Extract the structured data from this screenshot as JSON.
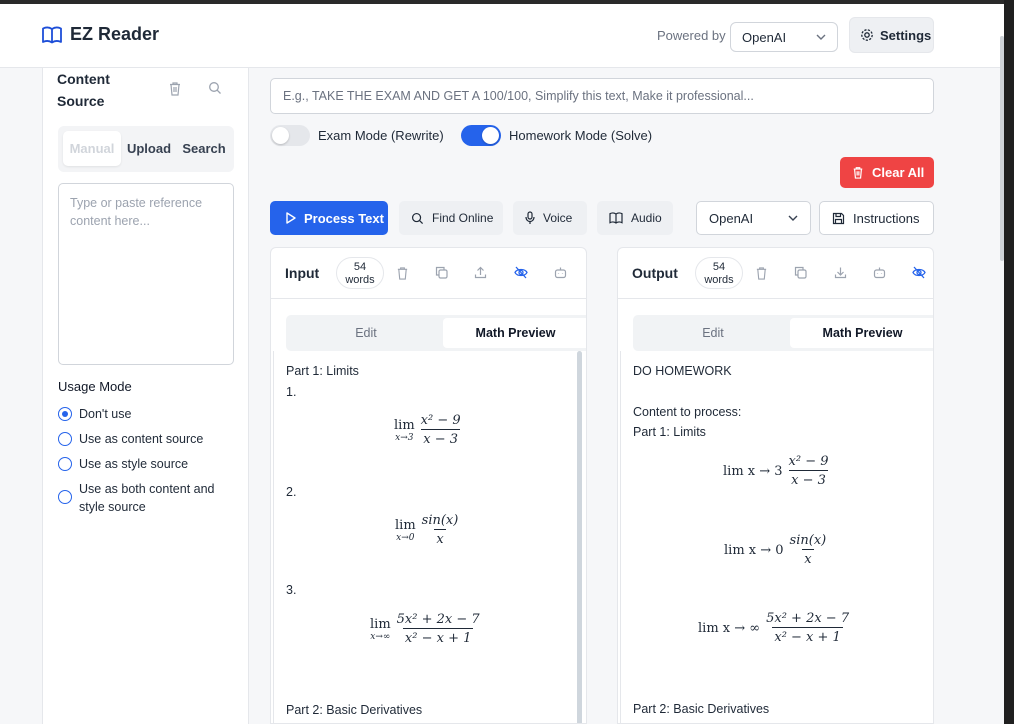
{
  "app": {
    "title": "EZ Reader",
    "powered_by": "Powered by",
    "provider": "OpenAI",
    "settings_label": "Settings"
  },
  "sidebar": {
    "title": "Content Source",
    "tabs": [
      {
        "label": "Manual"
      },
      {
        "label": "Upload"
      },
      {
        "label": "Search"
      }
    ],
    "textarea_placeholder": "Type or paste reference content here...",
    "usage_title": "Usage Mode",
    "usage_options": [
      {
        "label": "Don't use",
        "checked": true
      },
      {
        "label": "Use as content source",
        "checked": false
      },
      {
        "label": "Use as style source",
        "checked": false
      },
      {
        "label": "Use as both content and style source",
        "checked": false
      }
    ]
  },
  "main": {
    "prompt_placeholder": "E.g., TAKE THE EXAM AND GET A 100/100, Simplify this text, Make it professional...",
    "exam_mode": {
      "label": "Exam Mode (Rewrite)",
      "on": false
    },
    "homework_mode": {
      "label": "Homework Mode (Solve)",
      "on": true
    },
    "clear_all": "Clear All",
    "toolbar": {
      "process": "Process Text",
      "find_online": "Find Online",
      "voice": "Voice",
      "audio": "Audio",
      "model": "OpenAI",
      "instructions": "Instructions"
    }
  },
  "input_panel": {
    "title": "Input",
    "word_count": "54",
    "word_unit": "words",
    "tabs": [
      "Edit",
      "Math Preview"
    ],
    "active_tab": "Math Preview",
    "lines": [
      "Part 1: Limits",
      "1.",
      "2.",
      "3.",
      "Part 2: Basic Derivatives"
    ],
    "math": [
      {
        "lim_sub": "x→3",
        "num": "x² − 9",
        "den": "x − 3"
      },
      {
        "lim_sub": "x→0",
        "num": "sin(x)",
        "den": "x"
      },
      {
        "lim_sub": "x→∞",
        "num": "5x² + 2x − 7",
        "den": "x² − x + 1"
      }
    ]
  },
  "output_panel": {
    "title": "Output",
    "word_count": "54",
    "word_unit": "words",
    "tabs": [
      "Edit",
      "Math Preview"
    ],
    "active_tab": "Math Preview",
    "lines": [
      "DO HOMEWORK",
      "Content to process:",
      "Part 1: Limits",
      "Part 2: Basic Derivatives"
    ],
    "math": [
      {
        "prefix": "lim x → 3",
        "num": "x² − 9",
        "den": "x − 3"
      },
      {
        "prefix": "lim x → 0",
        "num": "sin(x)",
        "den": "x"
      },
      {
        "prefix": "lim x → ∞",
        "num": "5x² + 2x − 7",
        "den": "x² − x + 1"
      }
    ]
  },
  "colors": {
    "accent": "#2563eb",
    "danger": "#ef4444"
  }
}
